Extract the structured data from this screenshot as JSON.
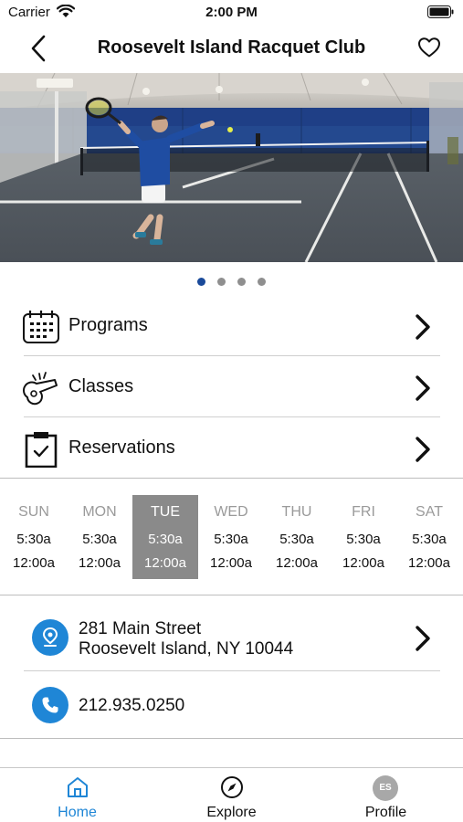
{
  "status_bar": {
    "carrier": "Carrier",
    "time": "2:00 PM"
  },
  "nav": {
    "title": "Roosevelt Island Racquet Club"
  },
  "carousel": {
    "page_count": 4,
    "active_index": 0
  },
  "menu": [
    {
      "label": "Programs",
      "icon": "calendar-icon"
    },
    {
      "label": "Classes",
      "icon": "whistle-icon"
    },
    {
      "label": "Reservations",
      "icon": "clipboard-check-icon"
    }
  ],
  "schedule": [
    {
      "day": "SUN",
      "open": "5:30a",
      "close": "12:00a",
      "selected": false
    },
    {
      "day": "MON",
      "open": "5:30a",
      "close": "12:00a",
      "selected": false
    },
    {
      "day": "TUE",
      "open": "5:30a",
      "close": "12:00a",
      "selected": true
    },
    {
      "day": "WED",
      "open": "5:30a",
      "close": "12:00a",
      "selected": false
    },
    {
      "day": "THU",
      "open": "5:30a",
      "close": "12:00a",
      "selected": false
    },
    {
      "day": "FRI",
      "open": "5:30a",
      "close": "12:00a",
      "selected": false
    },
    {
      "day": "SAT",
      "open": "5:30a",
      "close": "12:00a",
      "selected": false
    }
  ],
  "contact": {
    "address_line1": "281 Main Street",
    "address_line2": "Roosevelt Island, NY 10044",
    "phone": "212.935.0250"
  },
  "tabs": [
    {
      "label": "Home",
      "icon": "home-icon",
      "active": true
    },
    {
      "label": "Explore",
      "icon": "compass-icon",
      "active": false
    },
    {
      "label": "Profile",
      "icon": "avatar",
      "active": false
    }
  ],
  "profile": {
    "initials": "ES"
  },
  "colors": {
    "accent": "#1f86d6",
    "selected_day_bg": "#8a8a8a",
    "active_dot": "#1a4a9a"
  }
}
